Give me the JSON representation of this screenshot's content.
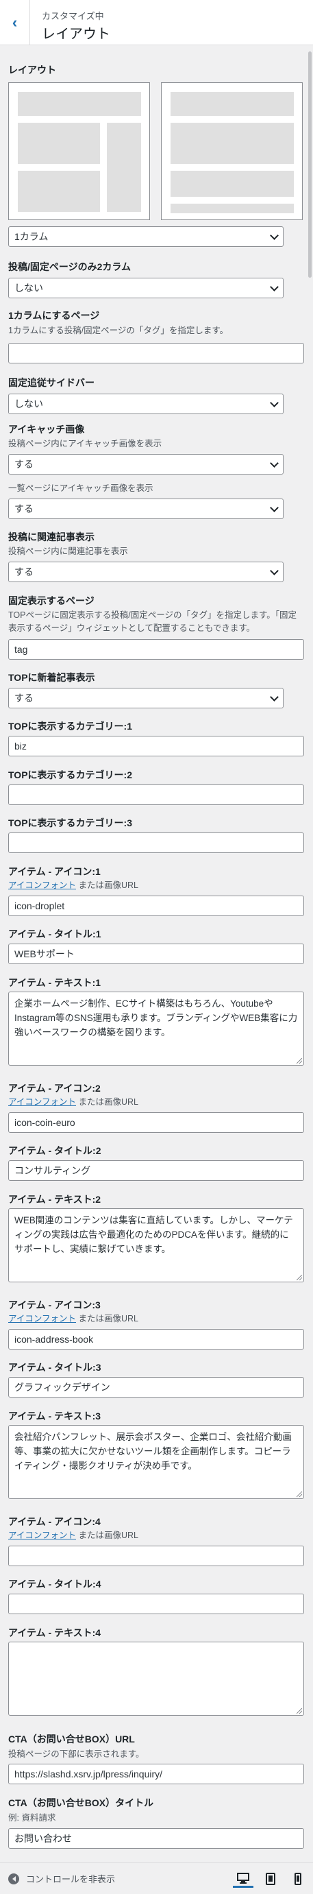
{
  "header": {
    "subtitle": "カスタマイズ中",
    "title": "レイアウト"
  },
  "layout": {
    "section_title": "レイアウト",
    "select_value": "1カラム"
  },
  "two_col": {
    "label": "投稿/固定ページのみ2カラム",
    "value": "しない"
  },
  "one_col": {
    "label": "1カラムにするページ",
    "desc": "1カラムにする投稿/固定ページの「タグ」を指定します。",
    "value": ""
  },
  "sidebar": {
    "label": "固定追従サイドバー",
    "value": "しない"
  },
  "eyecatch": {
    "label": "アイキャッチ画像",
    "post_desc": "投稿ページ内にアイキャッチ画像を表示",
    "post_value": "する",
    "list_desc": "一覧ページにアイキャッチ画像を表示",
    "list_value": "する"
  },
  "related": {
    "label": "投稿に関連記事表示",
    "desc": "投稿ページ内に関連記事を表示",
    "value": "する"
  },
  "fixed_page": {
    "label": "固定表示するページ",
    "desc": "TOPページに固定表示する投稿/固定ページの「タグ」を指定します。「固定表示するページ」ウィジェットとして配置することもできます。",
    "value": "tag"
  },
  "top_new": {
    "label": "TOPに新着記事表示",
    "value": "する"
  },
  "top_cat1": {
    "label": "TOPに表示するカテゴリー:1",
    "value": "biz"
  },
  "top_cat2": {
    "label": "TOPに表示するカテゴリー:2",
    "value": ""
  },
  "top_cat3": {
    "label": "TOPに表示するカテゴリー:3",
    "value": ""
  },
  "icon_font_link": "アイコンフォント",
  "icon_desc_suffix": " または画像URL",
  "items": [
    {
      "icon_label": "アイテム - アイコン:1",
      "icon_value": "icon-droplet",
      "title_label": "アイテム - タイトル:1",
      "title_value": "WEBサポート",
      "text_label": "アイテム - テキスト:1",
      "text_value": "企業ホームページ制作、ECサイト構築はもちろん、YoutubeやInstagram等のSNS運用も承ります。ブランディングやWEB集客に力強いベースワークの構築を図ります。"
    },
    {
      "icon_label": "アイテム - アイコン:2",
      "icon_value": "icon-coin-euro",
      "title_label": "アイテム - タイトル:2",
      "title_value": "コンサルティング",
      "text_label": "アイテム - テキスト:2",
      "text_value": "WEB関連のコンテンツは集客に直結しています。しかし、マーケティングの実践は広告や最適化のためのPDCAを伴います。継続的にサポートし、実績に繋げていきます。"
    },
    {
      "icon_label": "アイテム - アイコン:3",
      "icon_value": "icon-address-book",
      "title_label": "アイテム - タイトル:3",
      "title_value": "グラフィックデザイン",
      "text_label": "アイテム - テキスト:3",
      "text_value": "会社紹介パンフレット、展示会ポスター、企業ロゴ、会社紹介動画等、事業の拡大に欠かせないツール類を企画制作します。コピーライティング・撮影クオリティが決め手です。"
    },
    {
      "icon_label": "アイテム - アイコン:4",
      "icon_value": "",
      "title_label": "アイテム - タイトル:4",
      "title_value": "",
      "text_label": "アイテム - テキスト:4",
      "text_value": ""
    }
  ],
  "cta_url": {
    "label": "CTA（お問い合せBOX）URL",
    "desc": "投稿ページの下部に表示されます。",
    "value": "https://slashd.xsrv.jp/lpress/inquiry/"
  },
  "cta_title": {
    "label": "CTA（お問い合せBOX）タイトル",
    "desc": "例: 資料請求",
    "value": "お問い合わせ"
  },
  "footer": {
    "hide_controls": "コントロールを非表示"
  },
  "colors": {
    "accent": "#2271b1",
    "bg": "#f0f0f1",
    "border": "#8c8f94"
  }
}
